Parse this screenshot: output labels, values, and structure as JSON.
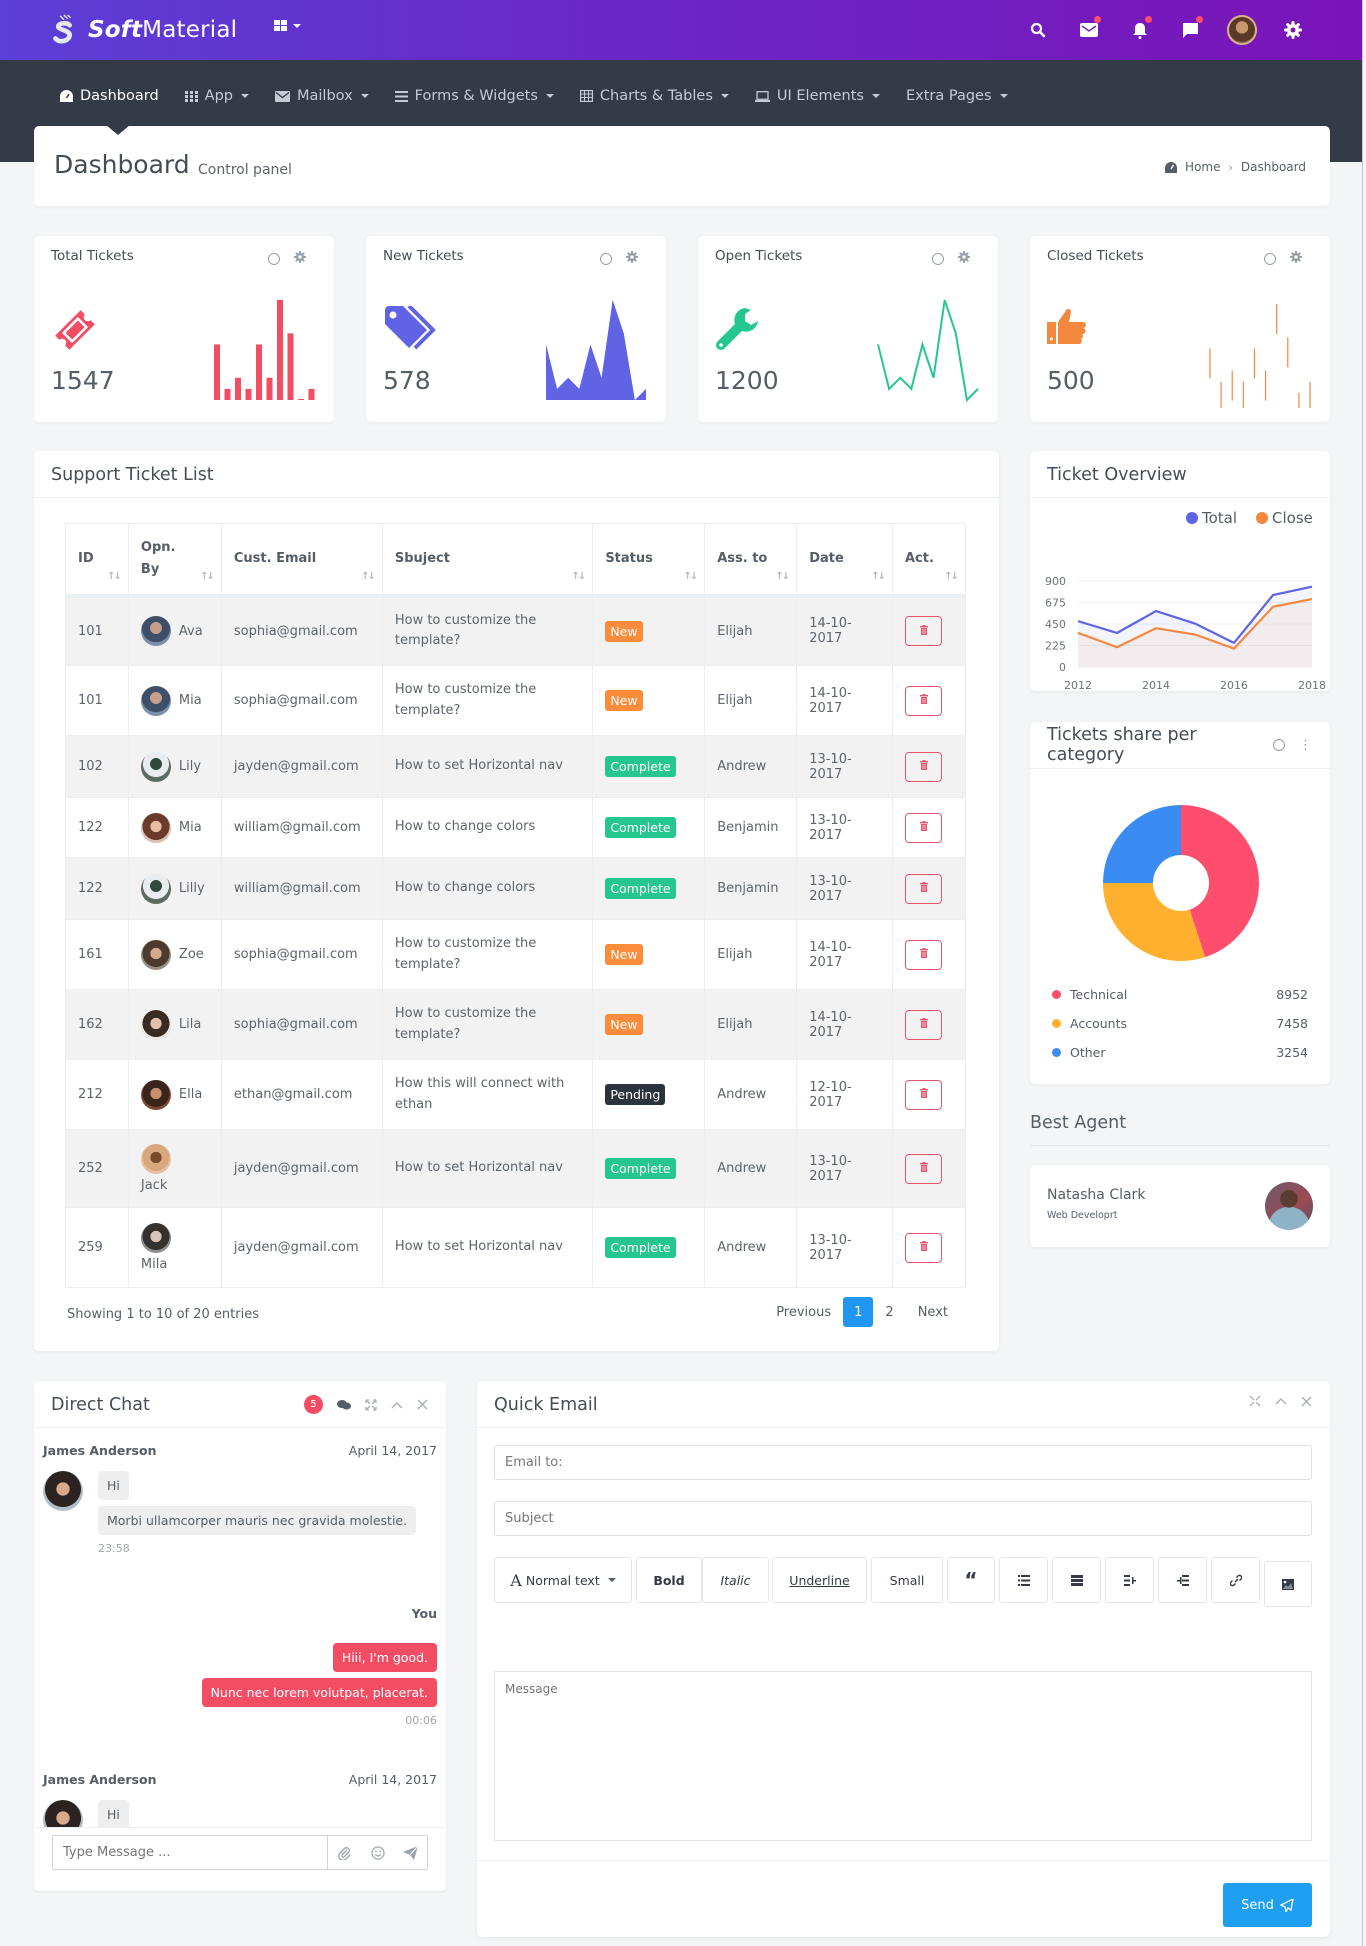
{
  "app": {
    "brand_bold": "Soft",
    "brand_light": "Material"
  },
  "topbar": {
    "icons": [
      "search-icon",
      "mail-icon",
      "bell-icon",
      "message-icon",
      "user-avatar",
      "gear-icon"
    ],
    "notification_dots": {
      "mail": true,
      "bell": true,
      "message": true
    }
  },
  "nav": {
    "items": [
      {
        "label": "Dashboard",
        "icon": "dashboard-icon",
        "active": true
      },
      {
        "label": "App",
        "icon": "grid-icon",
        "dropdown": true
      },
      {
        "label": "Mailbox",
        "icon": "envelope-icon",
        "dropdown": true
      },
      {
        "label": "Forms & Widgets",
        "icon": "list-icon",
        "dropdown": true
      },
      {
        "label": "Charts & Tables",
        "icon": "table-icon",
        "dropdown": true
      },
      {
        "label": "UI Elements",
        "icon": "laptop-icon",
        "dropdown": true
      },
      {
        "label": "Extra Pages",
        "icon": "",
        "dropdown": true
      }
    ]
  },
  "page_header": {
    "title": "Dashboard",
    "subtitle": "Control panel",
    "breadcrumb": [
      "Home",
      "Dashboard"
    ]
  },
  "stats": [
    {
      "title": "Total Tickets",
      "value": "1547",
      "color": "#f34d64",
      "icon": "ticket-icon",
      "spark_type": "bar",
      "spark": [
        5,
        1,
        2,
        1,
        5,
        2,
        9,
        6,
        0,
        1
      ]
    },
    {
      "title": "New Tickets",
      "value": "578",
      "color": "#5f63e4",
      "icon": "tags-icon",
      "spark_type": "area",
      "spark": [
        5,
        1,
        2,
        1,
        5,
        2,
        9,
        6,
        0,
        1
      ]
    },
    {
      "title": "Open Tickets",
      "value": "1200",
      "color": "#26c78f",
      "icon": "wrench-icon",
      "spark_type": "line",
      "spark": [
        5,
        1,
        2,
        1,
        5,
        2,
        9,
        6,
        0,
        1
      ]
    },
    {
      "title": "Closed Tickets",
      "value": "500",
      "color": "#f5883f",
      "icon": "thumbs-up-icon",
      "spark_type": "discrete",
      "spark": [
        5,
        2,
        3,
        2,
        5,
        3,
        9,
        6,
        1,
        2
      ]
    }
  ],
  "ticket_list": {
    "title": "Support Ticket List",
    "columns": [
      {
        "label": "ID"
      },
      {
        "label": "Opn. By"
      },
      {
        "label": "Cust. Email"
      },
      {
        "label": "Sbuject"
      },
      {
        "label": "Status"
      },
      {
        "label": "Ass. to"
      },
      {
        "label": "Date"
      },
      {
        "label": "Act."
      }
    ],
    "rows": [
      {
        "id": "101",
        "by": "Ava",
        "email": "sophia@gmail.com",
        "subject": "How to customize the template?",
        "status": "New",
        "assigned": "Elijah",
        "date": "14-10-2017"
      },
      {
        "id": "101",
        "by": "Mia",
        "email": "sophia@gmail.com",
        "subject": "How to customize the template?",
        "status": "New",
        "assigned": "Elijah",
        "date": "14-10-2017"
      },
      {
        "id": "102",
        "by": "Lily",
        "email": "jayden@gmail.com",
        "subject": "How to set Horizontal nav",
        "status": "Complete",
        "assigned": "Andrew",
        "date": "13-10-2017"
      },
      {
        "id": "122",
        "by": "Mia",
        "email": "william@gmail.com",
        "subject": "How to change colors",
        "status": "Complete",
        "assigned": "Benjamin",
        "date": "13-10-2017"
      },
      {
        "id": "122",
        "by": "Lilly",
        "email": "william@gmail.com",
        "subject": "How to change colors",
        "status": "Complete",
        "assigned": "Benjamin",
        "date": "13-10-2017"
      },
      {
        "id": "161",
        "by": "Zoe",
        "email": "sophia@gmail.com",
        "subject": "How to customize the template?",
        "status": "New",
        "assigned": "Elijah",
        "date": "14-10-2017"
      },
      {
        "id": "162",
        "by": "Lila",
        "email": "sophia@gmail.com",
        "subject": "How to customize the template?",
        "status": "New",
        "assigned": "Elijah",
        "date": "14-10-2017"
      },
      {
        "id": "212",
        "by": "Ella",
        "email": "ethan@gmail.com",
        "subject": "How this will connect with ethan",
        "status": "Pending",
        "assigned": "Andrew",
        "date": "12-10-2017"
      },
      {
        "id": "252",
        "by": "Jack",
        "email": "jayden@gmail.com",
        "subject": "How to set Horizontal nav",
        "status": "Complete",
        "assigned": "Andrew",
        "date": "13-10-2017"
      },
      {
        "id": "259",
        "by": "Mila",
        "email": "jayden@gmail.com",
        "subject": "How to set Horizontal nav",
        "status": "Complete",
        "assigned": "Andrew",
        "date": "13-10-2017"
      }
    ],
    "status_colors": {
      "New": "#fb8c3c",
      "Complete": "#26c78f",
      "Pending": "#2b333e"
    },
    "info": "Showing 1 to 10 of 20 entries",
    "pagination": {
      "previous": "Previous",
      "pages": [
        "1",
        "2"
      ],
      "current": "1",
      "next": "Next"
    }
  },
  "overview": {
    "title": "Ticket Overview"
  },
  "share": {
    "title": "Tickets share per category",
    "legend": [
      {
        "label": "Technical",
        "value": "8952",
        "color": "#ff4d6d"
      },
      {
        "label": "Accounts",
        "value": "7458",
        "color": "#ffb02e"
      },
      {
        "label": "Other",
        "value": "3254",
        "color": "#3a8bf2"
      }
    ]
  },
  "chart_data": [
    {
      "type": "line",
      "title": "Ticket Overview",
      "x": [
        "2012",
        "2013",
        "2014",
        "2015",
        "2016",
        "2017",
        "2018"
      ],
      "xticks": [
        "2012",
        "2014",
        "2016",
        "2018"
      ],
      "series": [
        {
          "name": "Total",
          "color": "#5f63e4",
          "values": [
            480,
            357,
            585,
            455,
            252,
            753,
            840
          ]
        },
        {
          "name": "Close",
          "color": "#f5883f",
          "values": [
            357,
            207,
            406,
            340,
            193,
            630,
            711
          ]
        }
      ],
      "ylim": [
        0,
        900
      ],
      "yticks": [
        0,
        225,
        450,
        675,
        900
      ],
      "legend": "top-right",
      "grid": true
    },
    {
      "type": "pie",
      "title": "Tickets share per category",
      "donut": true,
      "categories": [
        "Technical",
        "Accounts",
        "Other"
      ],
      "values": [
        45,
        30,
        25
      ],
      "colors": [
        "#ff4d6d",
        "#ffb02e",
        "#3a8bf2"
      ]
    }
  ],
  "best_agent": {
    "title": "Best Agent",
    "name": "Natasha Clark",
    "role": "Web Developrt"
  },
  "chat": {
    "title": "Direct Chat",
    "badge": "5",
    "messages": [
      {
        "from": "James Anderson",
        "date": "April 14, 2017",
        "lines": [
          "Hi",
          "Morbi ullamcorper mauris nec gravida molestie."
        ],
        "time": "23:58"
      },
      {
        "from": "You",
        "lines": [
          "Hiii, I'm good.",
          "Nunc nec lorem volutpat, placerat."
        ],
        "time": "00:06"
      },
      {
        "from": "James Anderson",
        "date": "April 14, 2017",
        "lines": [
          "Hi"
        ]
      }
    ],
    "input_placeholder": "Type Message ..."
  },
  "email": {
    "title": "Quick Email",
    "to_placeholder": "Email to:",
    "subject_placeholder": "Subject",
    "message_placeholder": "Message",
    "toolbar": {
      "format": "Normal text",
      "bold": "Bold",
      "italic": "Italic",
      "underline": "Underline",
      "small": "Small"
    },
    "send": "Send"
  }
}
